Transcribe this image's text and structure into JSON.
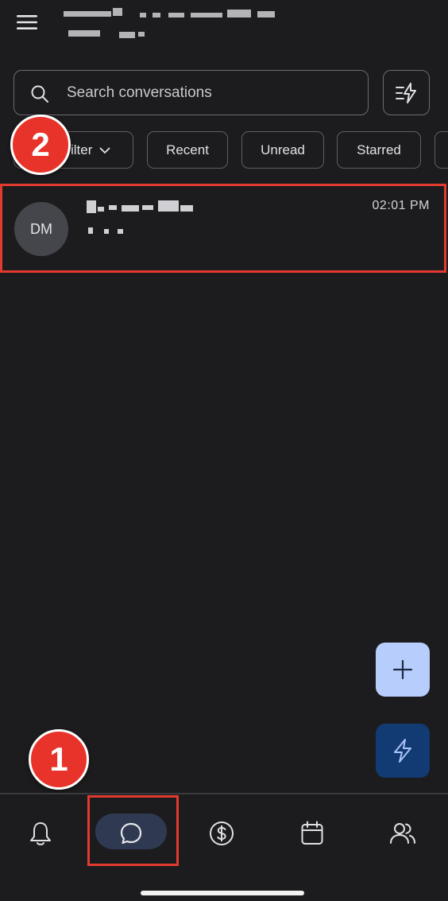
{
  "header": {
    "menu_icon": "hamburger-menu-icon"
  },
  "search": {
    "placeholder": "Search conversations",
    "value": ""
  },
  "filter_button_icon": "lightning-filter-icon",
  "chips": [
    {
      "label": "Filter"
    },
    {
      "label": "Recent"
    },
    {
      "label": "Unread"
    },
    {
      "label": "Starred"
    }
  ],
  "conversations": [
    {
      "initials": "DM",
      "time": "02:01 PM"
    }
  ],
  "fabs": {
    "add_icon": "plus-icon",
    "quick_icon": "lightning-icon"
  },
  "bottom_nav": [
    {
      "icon": "bell-icon",
      "active": false
    },
    {
      "icon": "chat-bubble-icon",
      "active": true
    },
    {
      "icon": "dollar-circle-icon",
      "active": false
    },
    {
      "icon": "calendar-icon",
      "active": false
    },
    {
      "icon": "users-icon",
      "active": false
    }
  ],
  "annotations": [
    {
      "number": "1"
    },
    {
      "number": "2"
    }
  ],
  "colors": {
    "background": "#1c1c1e",
    "highlight": "#e23a2f",
    "badge": "#e8332a",
    "fab_add": "#b7cdfb",
    "fab_quick": "#123a73",
    "nav_active": "#2f3a52"
  }
}
